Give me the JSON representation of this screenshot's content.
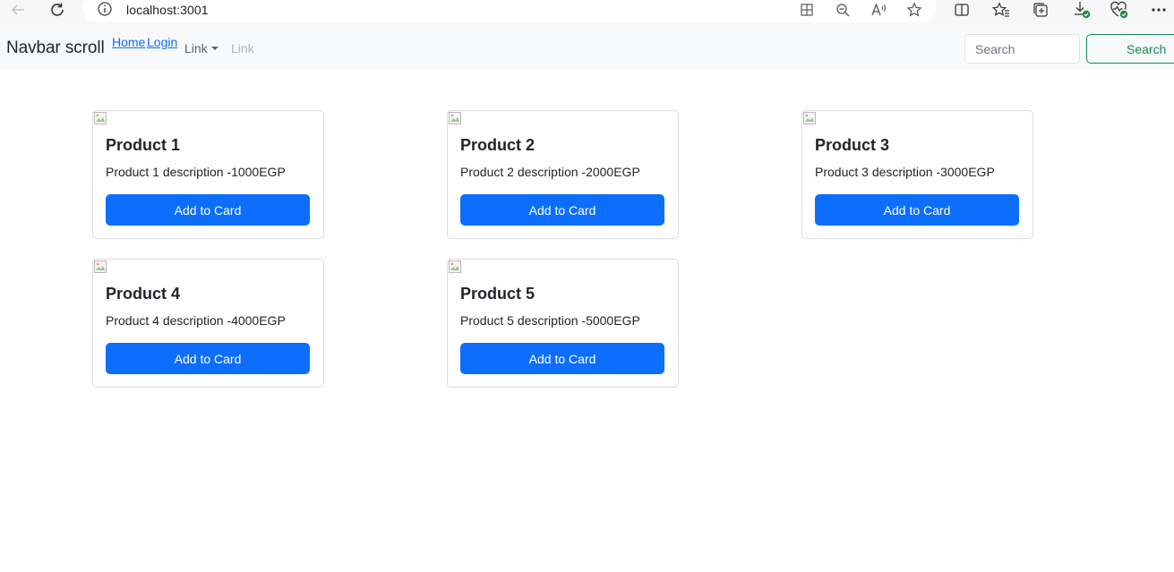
{
  "browser": {
    "url": "localhost:3001",
    "icons": [
      "back-icon",
      "refresh-icon",
      "info-icon",
      "app-grid-icon",
      "zoom-out-icon",
      "read-aloud-icon",
      "favorite-star-icon",
      "split-screen-icon",
      "favorites-icon",
      "collections-icon",
      "downloads-icon",
      "browser-essentials-icon",
      "more-icon"
    ]
  },
  "navbar": {
    "brand": "Navbar scroll",
    "links": {
      "home": "Home",
      "login": "Login",
      "dropdown": "Link",
      "disabled": "Link"
    },
    "search": {
      "placeholder": "Search",
      "button": "Search"
    }
  },
  "products": [
    {
      "title": "Product 1",
      "description": "Product 1 description -1000EGP",
      "button": "Add to Card"
    },
    {
      "title": "Product 2",
      "description": "Product 2 description -2000EGP",
      "button": "Add to Card"
    },
    {
      "title": "Product 3",
      "description": "Product 3 description -3000EGP",
      "button": "Add to Card"
    },
    {
      "title": "Product 4",
      "description": "Product 4 description -4000EGP",
      "button": "Add to Card"
    },
    {
      "title": "Product 5",
      "description": "Product 5 description -5000EGP",
      "button": "Add to Card"
    }
  ],
  "colors": {
    "primary": "#0d6efd",
    "success": "#198754",
    "navbar_bg": "#f8f9fa",
    "muted": "#adb5bd"
  }
}
